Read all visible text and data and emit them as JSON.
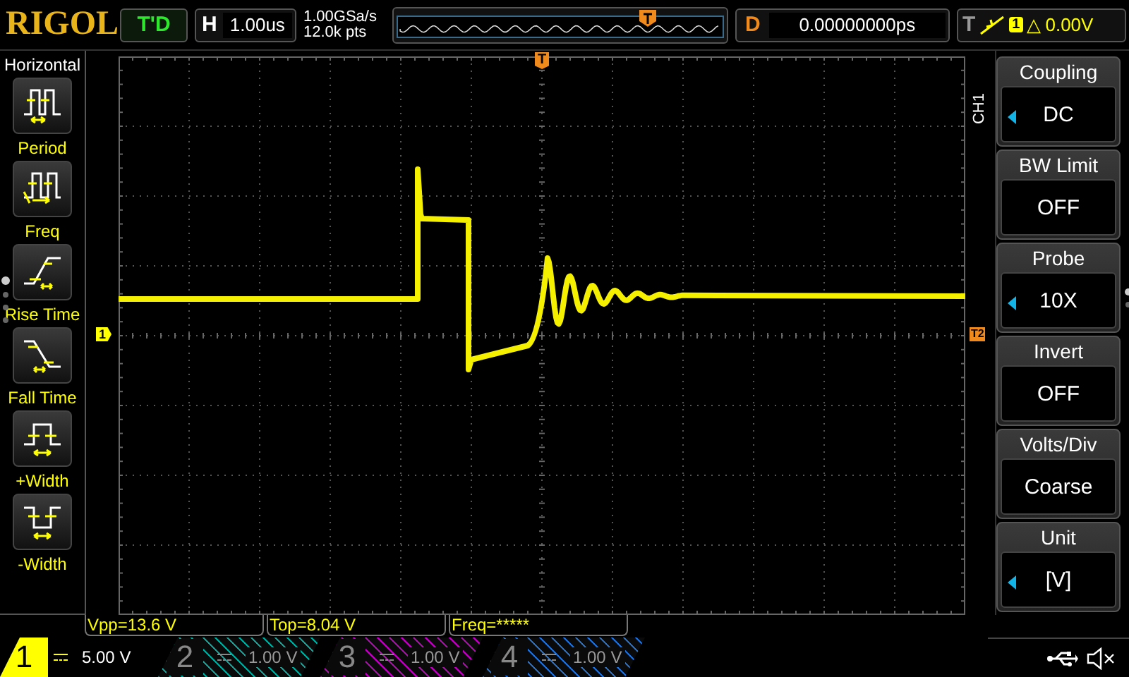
{
  "logo": "RIGOL",
  "run_status": "T'D",
  "horizontal": {
    "label": "H",
    "timebase": "1.00us"
  },
  "acquisition": {
    "sample_rate": "1.00GSa/s",
    "memory_depth": "12.0k pts"
  },
  "delay": {
    "label": "D",
    "value": "0.00000000ps"
  },
  "trigger": {
    "label": "T",
    "source": "1",
    "level_mark": "△",
    "level": "0.00V"
  },
  "markers": {
    "trigger_top": "T",
    "channel": "1",
    "trigger_right": "T2"
  },
  "left_menu": {
    "title": "Horizontal",
    "items": [
      {
        "kind": "period",
        "label": "Period"
      },
      {
        "kind": "freq",
        "label": "Freq"
      },
      {
        "kind": "rise",
        "label": "Rise Time"
      },
      {
        "kind": "fall",
        "label": "Fall Time"
      },
      {
        "kind": "pwidth",
        "label": "+Width"
      },
      {
        "kind": "nwidth",
        "label": "-Width"
      }
    ]
  },
  "right_menu": {
    "channel": "CH1",
    "items": [
      {
        "title": "Coupling",
        "value": "DC",
        "adjustable": true
      },
      {
        "title": "BW Limit",
        "value": "OFF",
        "adjustable": false
      },
      {
        "title": "Probe",
        "value": "10X",
        "adjustable": true
      },
      {
        "title": "Invert",
        "value": "OFF",
        "adjustable": false
      },
      {
        "title": "Volts/Div",
        "value": "Coarse",
        "adjustable": false
      },
      {
        "title": "Unit",
        "value": "[V]",
        "adjustable": true
      }
    ]
  },
  "measurements": [
    "Vpp=13.6 V",
    "Top=8.04 V",
    "Freq=*****"
  ],
  "channels": [
    {
      "number": "1",
      "scale": "5.00 V",
      "selected": true,
      "color": "#ffff00"
    },
    {
      "number": "2",
      "scale": "1.00 V",
      "selected": false,
      "color": "#00a89c"
    },
    {
      "number": "3",
      "scale": "1.00 V",
      "selected": false,
      "color": "#c000c0"
    },
    {
      "number": "4",
      "scale": "1.00 V",
      "selected": false,
      "color": "#1e6fd0"
    }
  ]
}
